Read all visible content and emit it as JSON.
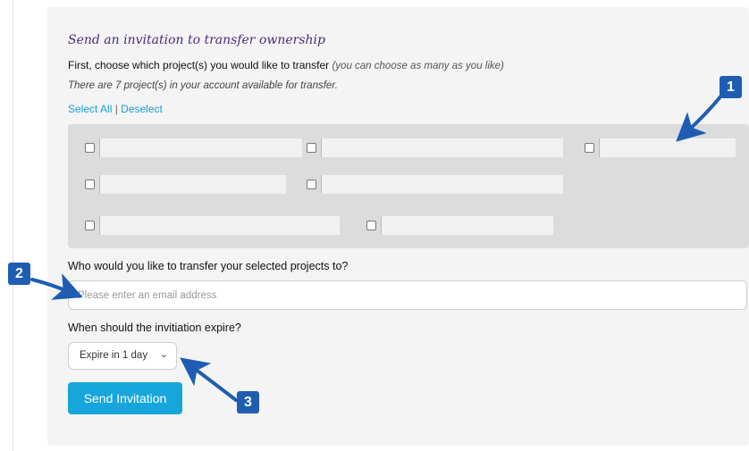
{
  "form": {
    "title": "Send an invitation to transfer ownership",
    "subtitle": "First, choose which project(s) you would like to transfer",
    "subtitle_note": "(you can choose as many as you like)",
    "count_text": "There are 7 project(s) in your account available for transfer.",
    "select_all": "Select All",
    "divider": "|",
    "deselect": "Deselect",
    "question": "Who would you like to transfer your selected projects to?",
    "email_placeholder": "Please enter an email address",
    "email_value": "",
    "expire_question": "When should the invitiation expire?",
    "expire_selected": "Expire in 1 day",
    "send_label": "Send Invitation"
  },
  "projects": [
    {
      "name": "",
      "checked": false
    },
    {
      "name": "",
      "checked": false
    },
    {
      "name": "",
      "checked": false
    },
    {
      "name": "",
      "checked": false
    },
    {
      "name": "",
      "checked": false
    },
    {
      "name": "",
      "checked": false
    },
    {
      "name": "",
      "checked": false
    }
  ],
  "callouts": [
    "1",
    "2",
    "3"
  ],
  "colors": {
    "accent": "#17a6dc",
    "title": "#4a2c7a",
    "badge": "#1f5db3",
    "panel": "#dcdcdc"
  }
}
